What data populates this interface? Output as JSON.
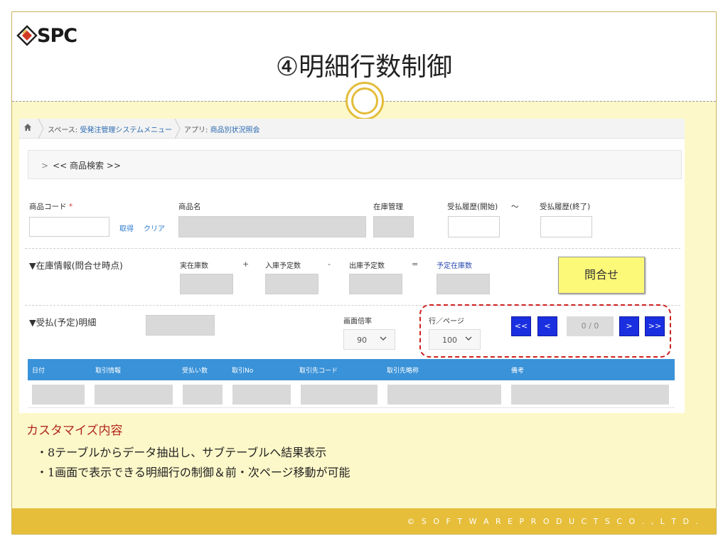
{
  "slide": {
    "logo_text": "SPC",
    "title": "④明細行数制御",
    "copyright": "© S O F T W A R E P R O D U C T S  C O . , L T D ."
  },
  "breadcrumbs": {
    "space_key": "スペース: ",
    "space_value": "受発注管理システムメニュー",
    "app_key": "アプリ: ",
    "app_value": "商品別状況照会"
  },
  "search": {
    "toggle_label": "<< 商品検索 >>"
  },
  "fields": {
    "product_code_label": "商品コード",
    "required_mark": "*",
    "fetch_link": "取得",
    "clear_link": "クリア",
    "product_name_label": "商品名",
    "stock_mgmt_label": "在庫管理",
    "history_start_label": "受払履歴(開始)",
    "tilde": "～",
    "history_end_label": "受払履歴(終了)"
  },
  "stock": {
    "section_title": "▼在庫情報(問合せ時点)",
    "actual_label": "実在庫数",
    "plus": "+",
    "incoming_label": "入庫予定数",
    "minus": "-",
    "outgoing_label": "出庫予定数",
    "equals": "=",
    "planned_label": "予定在庫数",
    "query_button": "問合せ"
  },
  "detail": {
    "section_title": "▼受払(予定)明細",
    "zoom_label": "画面倍率",
    "zoom_value": "90",
    "rows_label": "行／ページ",
    "rows_value": "100",
    "first_btn": "<<",
    "prev_btn": "<",
    "page_count": "0 /  0",
    "next_btn": ">",
    "last_btn": ">>"
  },
  "table": {
    "columns": [
      "日付",
      "取引情報",
      "受払い数",
      "取引No",
      "取引先コード",
      "取引先略称",
      "備考"
    ]
  },
  "notes": {
    "title": "カスタマイズ内容",
    "items": [
      "・8テーブルからデータ抽出し、サブテーブルへ結果表示",
      "・1画面で表示できる明細行の制御＆前・次ページ移動が可能"
    ]
  },
  "colors": {
    "accent_gold": "#e6be3a",
    "header_blue": "#3a92d8",
    "pager_blue": "#1a2fe0",
    "highlight_red": "#cc2020",
    "query_yellow": "#fcf878"
  },
  "icons": [
    "home-icon",
    "chevron-right-icon",
    "chevron-down-icon",
    "spc-logo-icon"
  ]
}
